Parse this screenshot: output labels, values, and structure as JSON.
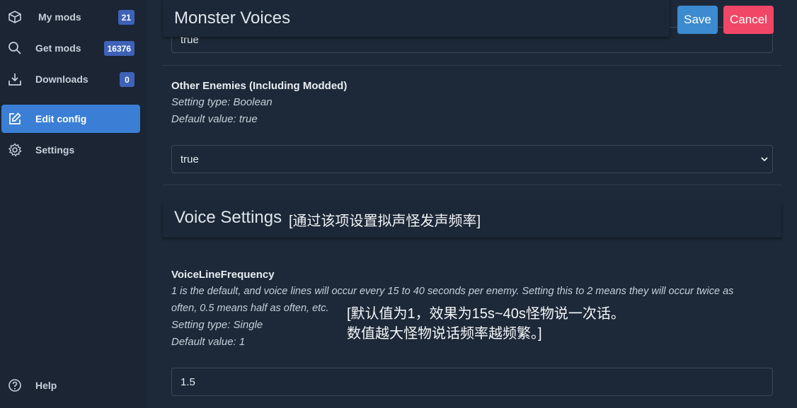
{
  "sidebar": {
    "items": [
      {
        "label": "My mods",
        "badge": "21"
      },
      {
        "label": "Get mods",
        "badge": "16376"
      },
      {
        "label": "Downloads",
        "badge": "0"
      },
      {
        "label": "Edit config"
      },
      {
        "label": "Settings"
      }
    ],
    "help_label": "Help"
  },
  "header": {
    "title": "Monster Voices",
    "save_label": "Save",
    "cancel_label": "Cancel"
  },
  "top_field": {
    "value": "true"
  },
  "settings": [
    {
      "name": "Other Enemies (Including Modded)",
      "type": "Setting type: Boolean",
      "default": "Default value: true",
      "value": "true"
    },
    {
      "name": "VoiceLineFrequency",
      "description_line1": "1 is the default, and voice lines will occur every 15 to 40 seconds per enemy. Setting this to 2 means they will occur twice as",
      "description_line2": "often, 0.5 means half as often, etc.",
      "type": "Setting type: Single",
      "default": "Default value: 1",
      "value": "1.5"
    }
  ],
  "section": {
    "title": "Voice Settings",
    "note": "[通过该项设置拟声怪发声频率]"
  },
  "annotation": {
    "line1": "[默认值为1，效果为15s~40s怪物说一次话。",
    "line2": "数值越大怪物说话频率越频繁。]"
  },
  "colors": {
    "accent": "#3a7fd5",
    "save": "#3c8bd0",
    "cancel": "#f14766",
    "badge": "#3e62b8"
  }
}
